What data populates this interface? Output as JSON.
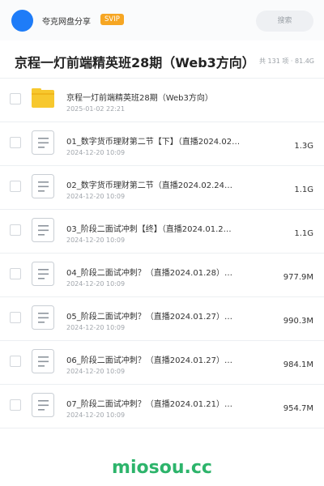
{
  "header": {
    "brand": "夸克网盘分享",
    "badge": "SVIP",
    "search_placeholder": "搜索"
  },
  "folder": {
    "title": "京程一灯前端精英班28期（Web3方向）",
    "meta": "共 131 项 · 81.4G"
  },
  "colors": {
    "accent": "#1e7cf8",
    "badge": "#f6a623",
    "folder": "#f7c82e",
    "watermark": "#2db46b"
  },
  "items": [
    {
      "type": "folder-icon",
      "name": "京程一灯前端精英班28期（Web3方向）",
      "date": "2025-01-02 22:21",
      "size": ""
    },
    {
      "type": "file-icon",
      "name": "01_数字货币理财第二节【下】（直播2024.02…",
      "date": "2024-12-20 10:09",
      "size": "1.3G"
    },
    {
      "type": "file-icon",
      "name": "02_数字货币理财第二节（直播2024.02.24…",
      "date": "2024-12-20 10:09",
      "size": "1.1G"
    },
    {
      "type": "file-icon",
      "name": "03_阶段二面试冲刺【终】（直播2024.01.2…",
      "date": "2024-12-20 10:09",
      "size": "1.1G"
    },
    {
      "type": "file-icon",
      "name": "04_阶段二面试冲刺？（直播2024.01.28）…",
      "date": "2024-12-20 10:09",
      "size": "977.9M"
    },
    {
      "type": "file-icon",
      "name": "05_阶段二面试冲刺？（直播2024.01.27）…",
      "date": "2024-12-20 10:09",
      "size": "990.3M"
    },
    {
      "type": "file-icon",
      "name": "06_阶段二面试冲刺？（直播2024.01.27）…",
      "date": "2024-12-20 10:09",
      "size": "984.1M"
    },
    {
      "type": "file-icon",
      "name": "07_阶段二面试冲刺？（直播2024.01.21）…",
      "date": "2024-12-20 10:09",
      "size": "954.7M"
    }
  ],
  "watermark": "miosou.cc"
}
